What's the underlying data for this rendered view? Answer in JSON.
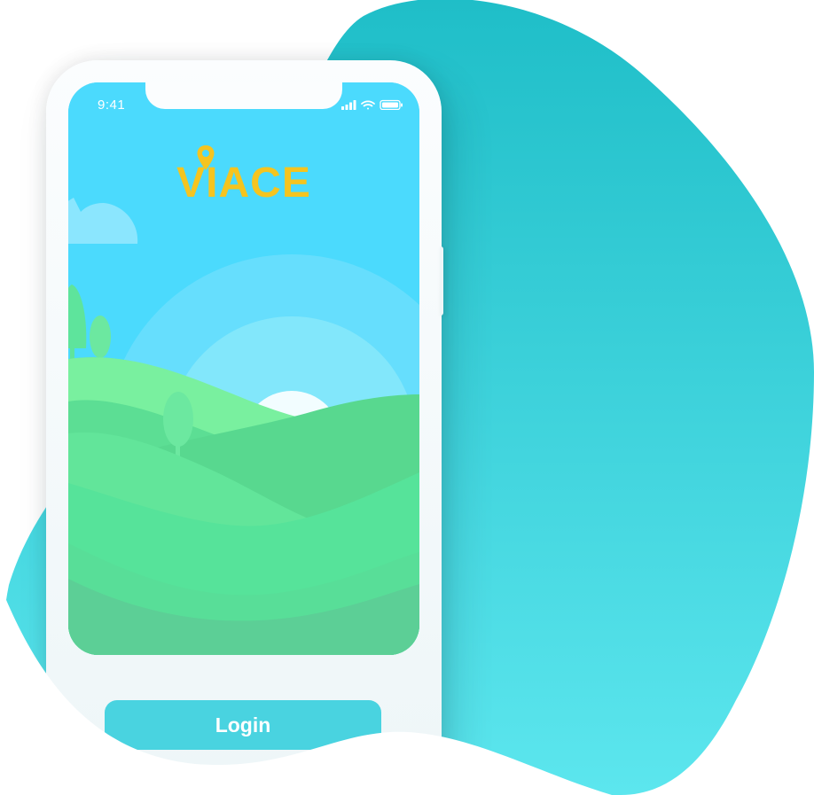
{
  "status_bar": {
    "time": "9:41"
  },
  "app": {
    "logo_text": "VIACE"
  },
  "actions": {
    "login_label": "Login"
  },
  "colors": {
    "blob_top": "#1fbec8",
    "blob_bottom": "#5ce6ee",
    "sky": "#4bdafd",
    "logo": "#f5c41f",
    "login_button": "#49d3e0",
    "hills": "#57dc94"
  },
  "icons": [
    "signal-icon",
    "wifi-icon",
    "battery-icon",
    "location-pin-icon"
  ]
}
